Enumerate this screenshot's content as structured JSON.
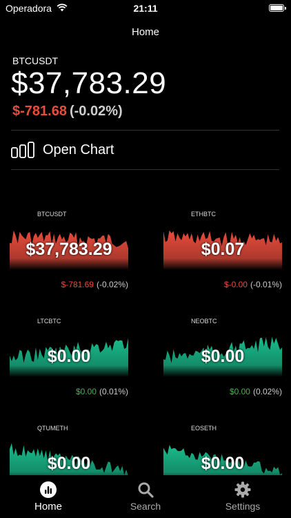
{
  "status": {
    "carrier": "Operadora",
    "time": "21:11"
  },
  "nav": {
    "title": "Home"
  },
  "selected": {
    "symbol": "BTCUSDT",
    "price": "$37,783.29",
    "change": "$-781.68",
    "pct": "(-0.02%)"
  },
  "open_chart": {
    "label": "Open Chart"
  },
  "cards": [
    {
      "symbol": "BTCUSDT",
      "price": "$37,783.29",
      "change": "$-781.69",
      "pct": "(-0.02%)",
      "trend": "down",
      "color": "#e74c3c"
    },
    {
      "symbol": "ETHBTC",
      "price": "$0.07",
      "change": "$-0.00",
      "pct": "(-0.01%)",
      "trend": "down",
      "color": "#e74c3c"
    },
    {
      "symbol": "LTCBTC",
      "price": "$0.00",
      "change": "$0.00",
      "pct": "(0.01%)",
      "trend": "up",
      "color": "#1abc8c"
    },
    {
      "symbol": "NEOBTC",
      "price": "$0.00",
      "change": "$0.00",
      "pct": "(0.02%)",
      "trend": "up",
      "color": "#1abc8c"
    },
    {
      "symbol": "QTUMETH",
      "price": "$0.00",
      "trend": "up",
      "color": "#1abc8c"
    },
    {
      "symbol": "EOSETH",
      "price": "$0.00",
      "trend": "up",
      "color": "#1abc8c"
    }
  ],
  "tabs": [
    {
      "label": "Home",
      "icon": "chart-circle-icon",
      "active": true
    },
    {
      "label": "Search",
      "icon": "search-icon",
      "active": false
    },
    {
      "label": "Settings",
      "icon": "gear-icon",
      "active": false
    }
  ],
  "colors": {
    "negative": "#e74c3c",
    "positive": "#4caf50",
    "area_up": "#1abc8c",
    "area_down": "#e74c3c"
  }
}
